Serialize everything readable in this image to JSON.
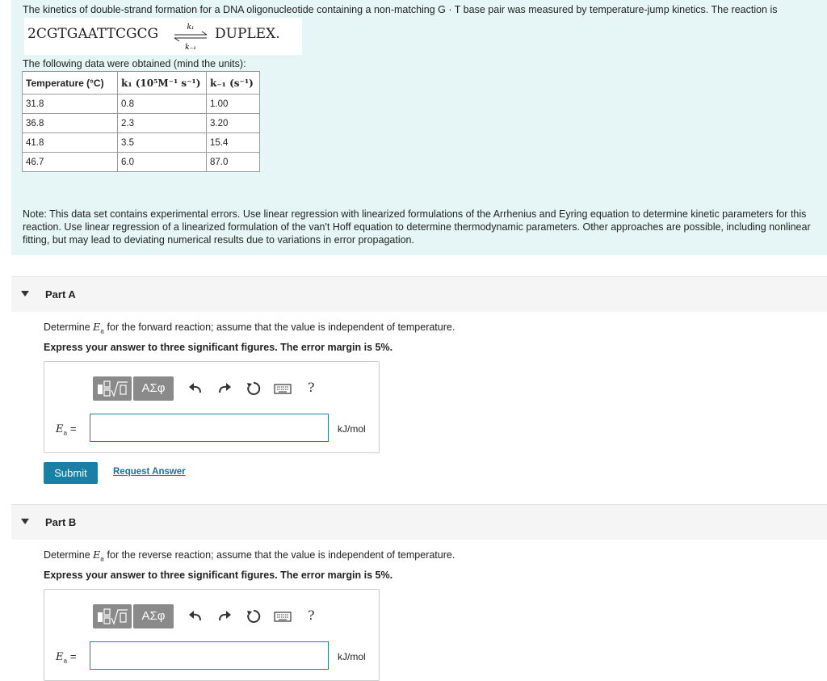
{
  "intro": {
    "text": "The kinetics of double-strand formation for a DNA oligonucleotide containing a non-matching G · T base pair was measured by temperature-jump kinetics. The reaction is",
    "reactant": "2CGTGAATTCGCG",
    "product": "DUPLEX.",
    "k_forward": "k₁",
    "k_reverse": "k₋₁"
  },
  "table": {
    "caption": "The following data were obtained (mind the units):",
    "headers": [
      "Temperature (°C)",
      "k₁ (10⁵M⁻¹ s⁻¹)",
      "k₋₁ (s⁻¹)"
    ],
    "rows": [
      [
        "31.8",
        "0.8",
        "1.00"
      ],
      [
        "36.8",
        "2.3",
        "3.20"
      ],
      [
        "41.8",
        "3.5",
        "15.4"
      ],
      [
        "46.7",
        "6.0",
        "87.0"
      ]
    ]
  },
  "note": "Note: This data set contains experimental errors. Use linear regression with linearized formulations of the Arrhenius and Eyring equation to determine kinetic parameters for this reaction. Use linear regression of a linearized formulation of the van't Hoff equation to determine thermodynamic parameters. Other approaches are possible, including nonlinear fitting, but may lead to deviating numerical results due to variations in error propagation.",
  "toolbar": {
    "greek": "ΑΣφ",
    "help": "?"
  },
  "parts": [
    {
      "title": "Part A",
      "question_pre": "Determine ",
      "question_var": "E",
      "question_sub": "a",
      "question_post": " for the forward reaction; assume that the value is independent of temperature.",
      "instruction": "Express your answer to three significant figures. The error margin is 5%.",
      "answer_label": "E",
      "answer_sub": "a",
      "answer_eq": " =",
      "answer_value": "",
      "unit": "kJ/mol",
      "submit": "Submit",
      "request": "Request Answer"
    },
    {
      "title": "Part B",
      "question_pre": "Determine ",
      "question_var": "E",
      "question_sub": "a",
      "question_post": " for the reverse reaction; assume that the value is independent of temperature.",
      "instruction": "Express your answer to three significant figures. The error margin is 5%.",
      "answer_label": "E",
      "answer_sub": "a",
      "answer_eq": " =",
      "answer_value": "",
      "unit": "kJ/mol"
    }
  ]
}
